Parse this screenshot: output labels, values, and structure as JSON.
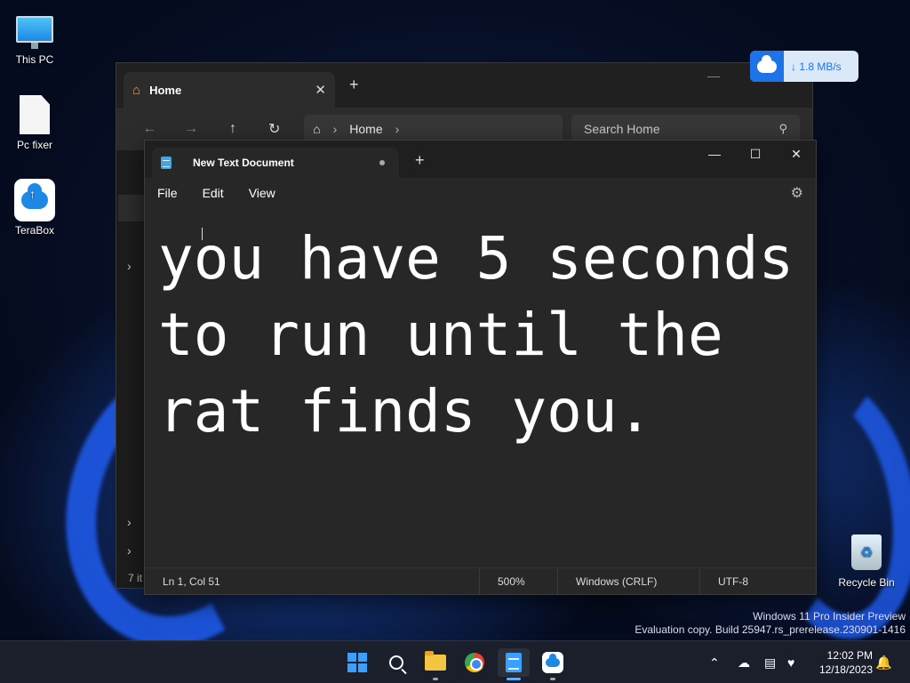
{
  "desktop": {
    "icons": [
      {
        "label": "This PC"
      },
      {
        "label": "Pc fixer"
      },
      {
        "label": "TeraBox"
      },
      {
        "label": "Recycle Bin"
      }
    ]
  },
  "explorer": {
    "tab_title": "Home",
    "new_tab": "+",
    "address": {
      "segment": "Home"
    },
    "search_placeholder": "Search Home",
    "status_text": "7 it"
  },
  "notepad": {
    "tab_title": "New Text Document",
    "new_tab": "+",
    "menus": [
      "File",
      "Edit",
      "View"
    ],
    "content": "you have 5 seconds to run until the rat finds you.",
    "status": {
      "position": "Ln 1, Col 51",
      "zoom": "500%",
      "line_ending": "Windows (CRLF)",
      "encoding": "UTF-8"
    },
    "unsaved": true
  },
  "terabox_speed": {
    "text": "↓ 1.8 MB/s"
  },
  "watermark": {
    "line1": "Windows 11 Pro Insider Preview",
    "line2": "Evaluation copy. Build 25947.rs_prerelease.230901-1416"
  },
  "taskbar": {
    "apps": [
      {
        "name": "start"
      },
      {
        "name": "search"
      },
      {
        "name": "file-explorer",
        "running": true
      },
      {
        "name": "chrome"
      },
      {
        "name": "notepad",
        "running": true,
        "active": true
      },
      {
        "name": "terabox",
        "running": true
      }
    ],
    "clock": {
      "time": "12:02 PM",
      "date": "12/18/2023"
    }
  },
  "colors": {
    "accent": "#3aa0ff",
    "window_bg": "#272727",
    "titlebar_bg": "#1f1f1f"
  }
}
